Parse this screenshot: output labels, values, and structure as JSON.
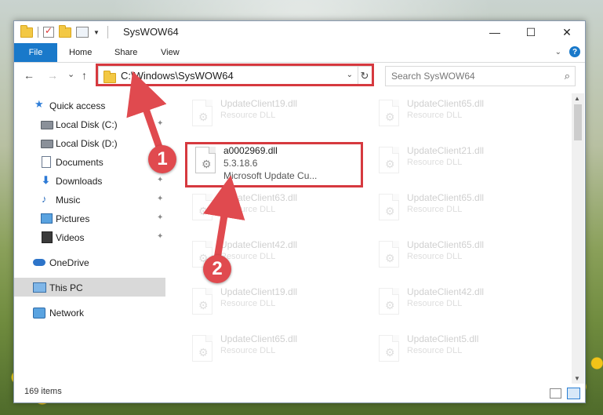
{
  "window": {
    "title": "SysWOW64",
    "controls": {
      "minimize": "—",
      "maximize": "☐",
      "close": "✕"
    }
  },
  "ribbon": {
    "tabs": [
      "File",
      "Home",
      "Share",
      "View"
    ],
    "collapse_icon": "chevron-down-icon",
    "help_label": "?"
  },
  "nav": {
    "back": "←",
    "forward": "→",
    "recent": "⌄",
    "up": "↑",
    "address": "C:\\Windows\\SysWOW64",
    "refresh": "↻",
    "search_placeholder": "Search SysWOW64",
    "search_icon": "⌕"
  },
  "sidebar": {
    "items": [
      {
        "label": "Quick access"
      },
      {
        "label": "Local Disk (C:)",
        "pinned": true
      },
      {
        "label": "Local Disk (D:)"
      },
      {
        "label": "Documents",
        "pinned": true
      },
      {
        "label": "Downloads",
        "pinned": true
      },
      {
        "label": "Music",
        "pinned": true
      },
      {
        "label": "Pictures",
        "pinned": true
      },
      {
        "label": "Videos",
        "pinned": true
      },
      {
        "label": "OneDrive"
      },
      {
        "label": "This PC"
      },
      {
        "label": "Network"
      }
    ],
    "pin_glyph": "📌"
  },
  "files": {
    "selected": {
      "name": "a0002969.dll",
      "version": "5.3.18.6",
      "description": "Microsoft Update Cu..."
    },
    "left_column": [
      {
        "name": "UpdateClient19.dll",
        "type": "Resource DLL"
      },
      {
        "name": "UpdateClient63.dll",
        "type": "Resource DLL"
      },
      {
        "name": "UpdateClient42.dll",
        "type": "Resource DLL"
      },
      {
        "name": "UpdateClient19.dll",
        "type": "Resource DLL"
      },
      {
        "name": "UpdateClient65.dll",
        "type": "Resource DLL"
      }
    ],
    "right_column": [
      {
        "name": "UpdateClient65.dll",
        "type": "Resource DLL"
      },
      {
        "name": "UpdateClient21.dll",
        "type": "Resource DLL"
      },
      {
        "name": "UpdateClient65.dll",
        "type": "Resource DLL"
      },
      {
        "name": "UpdateClient65.dll",
        "type": "Resource DLL"
      },
      {
        "name": "UpdateClient42.dll",
        "type": "Resource DLL"
      },
      {
        "name": "UpdateClient5.dll",
        "type": "Resource DLL"
      }
    ]
  },
  "status": {
    "item_count": "169 items"
  },
  "annotations": {
    "step1": "1",
    "step2": "2"
  },
  "colors": {
    "accent": "#1979ca",
    "highlight": "#d6393f",
    "callout": "#e04a4f"
  }
}
